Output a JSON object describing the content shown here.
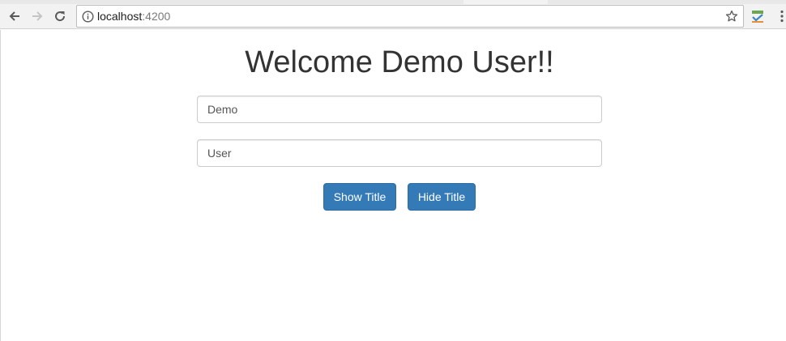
{
  "browser": {
    "url_host": "localhost",
    "url_port": ":4200",
    "icons": {
      "back": "back-arrow-icon",
      "forward": "forward-arrow-icon",
      "reload": "reload-icon",
      "site_info": "info-icon",
      "bookmark": "star-icon",
      "extension": "extension-icon",
      "menu": "kebab-menu-icon"
    }
  },
  "page": {
    "title": "Welcome Demo User!!",
    "first_name_value": "Demo",
    "last_name_value": "User",
    "show_title_label": "Show Title",
    "hide_title_label": "Hide Title"
  },
  "colors": {
    "primary_button": "#337ab7",
    "title_text": "#333333",
    "input_border": "#cccccc"
  }
}
